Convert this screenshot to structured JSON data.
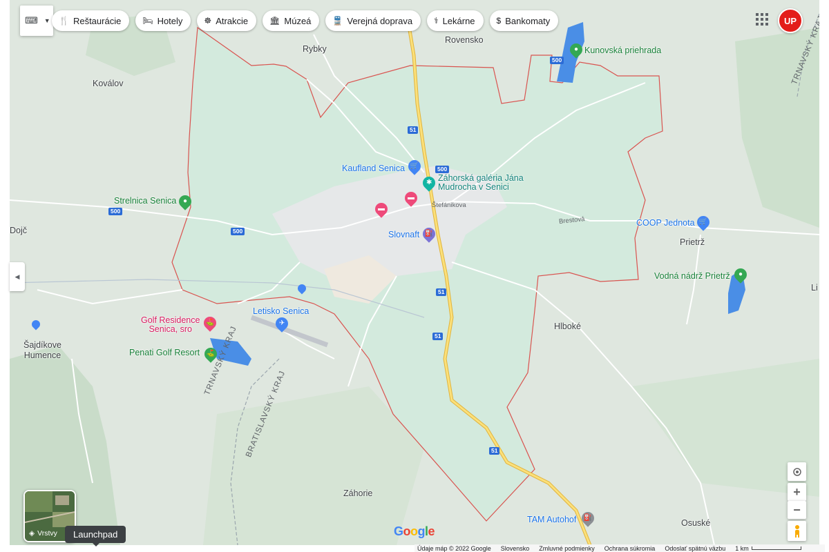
{
  "toolbar": {
    "keyboard_icon": "keyboard-icon",
    "chips": [
      {
        "label": "Reštaurácie",
        "icon": "fork-knife-icon"
      },
      {
        "label": "Hotely",
        "icon": "bed-icon"
      },
      {
        "label": "Atrakcie",
        "icon": "ferris-wheel-icon"
      },
      {
        "label": "Múzeá",
        "icon": "museum-icon"
      },
      {
        "label": "Verejná doprava",
        "icon": "train-icon"
      },
      {
        "label": "Lekárne",
        "icon": "pharmacy-icon"
      },
      {
        "label": "Bankomaty",
        "icon": "dollar-icon"
      }
    ]
  },
  "account": {
    "avatar_text": "UP"
  },
  "places": {
    "rybky": "Rybky",
    "rovensko": "Rovensko",
    "kovalov": "Koválov",
    "dojc": "Dojč",
    "pritrz": "Prietrž",
    "hlboke": "Hlboké",
    "sajdikove": "Šajdíkove\nHumence",
    "zahorie": "Záhorie",
    "osuske": "Osuské",
    "li": "Li"
  },
  "pois": {
    "kunovska": "Kunovská priehrada",
    "kaufland": "Kaufland Senica",
    "galeria": "Záhorská galéria Jána\nMudrocha v Senici",
    "strelnica": "Strelnica Senica",
    "slovnaft": "Slovnaft",
    "coop": "COOP Jednota",
    "vodna": "Vodná nádrž Prietrž",
    "golf_res": "Golf Residence\nSenica, sro",
    "letisko": "Letisko Senica",
    "penati": "Penati Golf Resort",
    "tam": "TAM Autohof"
  },
  "streets": {
    "stefanikova": "Štefánikova",
    "brestova": "Brestová"
  },
  "regions": {
    "trnavsky": "TRNAVSKÝ KRAJ",
    "bratislavsky": "BRATISLAVSKÝ KRAJ",
    "trnavsky_ne": "TRNAVSKÝ KRAJ"
  },
  "road_shields": [
    "500",
    "500",
    "500",
    "500",
    "51",
    "51",
    "51",
    "51"
  ],
  "controls": {
    "locate_icon": "my-location-icon",
    "zoom_in": "+",
    "zoom_out": "−",
    "pegman_icon": "pegman-icon",
    "layers_label": "Vrstvy",
    "tooltip": "Launchpad"
  },
  "branding": {
    "logo": "Google"
  },
  "footer": {
    "data": "Údaje máp © 2022 Google",
    "country": "Slovensko",
    "terms": "Zmluvné podmienky",
    "privacy": "Ochrana súkromia",
    "feedback": "Odoslať spätnú väzbu",
    "scale": "1 km"
  },
  "colors": {
    "boundary": "#d9534f",
    "highway": "#f2c94c",
    "water": "#4a8ee6",
    "land": "#dfe7df",
    "district": "#d3eadd"
  }
}
